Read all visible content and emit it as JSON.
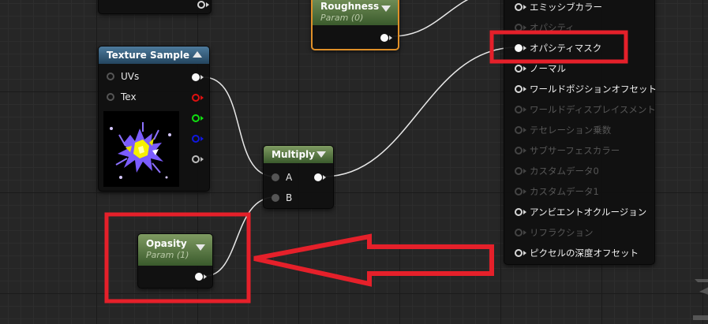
{
  "colors": {
    "highlight_red": "#e5202a",
    "wire": "#e8e8e8",
    "selected_node_border": "#e09028"
  },
  "top_partial_node": {
    "pin_icon": "pin-outline-icon"
  },
  "roughness_node": {
    "title": "Roughness",
    "subtitle": "Param (0)"
  },
  "texture_sample_node": {
    "title": "Texture Sample",
    "inputs": [
      "UVs",
      "Tex"
    ],
    "output_pin_colors": [
      "#ffffff",
      "#e01010",
      "#10e010",
      "#1018e0",
      "#bdbdbd"
    ]
  },
  "multiply_node": {
    "title": "Multiply",
    "inputs": [
      "A",
      "B"
    ]
  },
  "opacity_node": {
    "title": "Opasity",
    "subtitle": "Param (1)"
  },
  "result_node": {
    "pins": [
      {
        "label": "エミッシブカラー",
        "enabled": true,
        "connected": false
      },
      {
        "label": "オパシティ",
        "enabled": false,
        "connected": false
      },
      {
        "label": "オパシティマスク",
        "enabled": true,
        "connected": true
      },
      {
        "label": "ノーマル",
        "enabled": true,
        "connected": false
      },
      {
        "label": "ワールドポジションオフセット",
        "enabled": true,
        "connected": false
      },
      {
        "label": "ワールドディスプレイスメント",
        "enabled": false,
        "connected": false
      },
      {
        "label": "テセレーション乗数",
        "enabled": false,
        "connected": false
      },
      {
        "label": "サブサーフェスカラー",
        "enabled": false,
        "connected": false
      },
      {
        "label": "カスタムデータ0",
        "enabled": false,
        "connected": false
      },
      {
        "label": "カスタムデータ1",
        "enabled": false,
        "connected": false
      },
      {
        "label": "アンビエントオクルージョン",
        "enabled": true,
        "connected": false
      },
      {
        "label": "リフラクション",
        "enabled": false,
        "connected": false
      },
      {
        "label": "ピクセルの深度オフセット",
        "enabled": true,
        "connected": false
      }
    ]
  }
}
